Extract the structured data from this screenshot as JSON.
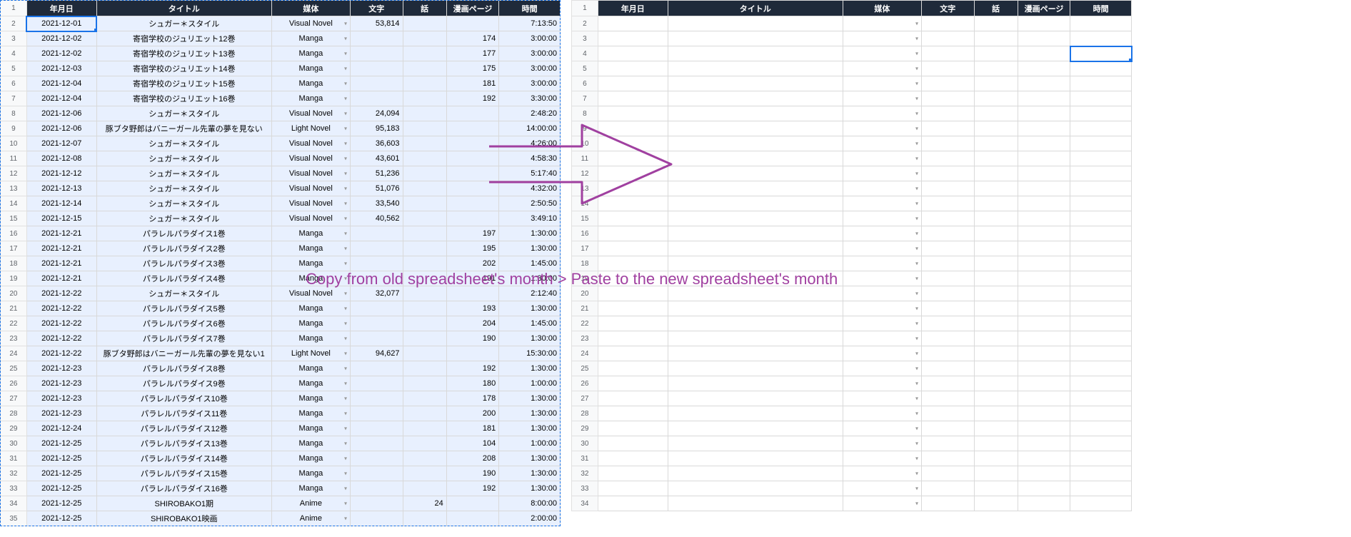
{
  "annotation": "Copy from old spreadsheet's month > Paste to the new spreadsheet's month",
  "headers": {
    "date": "年月日",
    "title": "タイトル",
    "media": "媒体",
    "moji": "文字",
    "wa": "話",
    "page": "漫画ページ",
    "time": "時間"
  },
  "rows": [
    {
      "n": 1
    },
    {
      "n": 2,
      "date": "2021-12-01",
      "title": "シュガー＊スタイル",
      "media": "Visual Novel",
      "moji": "53,814",
      "wa": "",
      "page": "",
      "time": "7:13:50"
    },
    {
      "n": 3,
      "date": "2021-12-02",
      "title": "寄宿学校のジュリエット12巻",
      "media": "Manga",
      "moji": "",
      "wa": "",
      "page": "174",
      "time": "3:00:00"
    },
    {
      "n": 4,
      "date": "2021-12-02",
      "title": "寄宿学校のジュリエット13巻",
      "media": "Manga",
      "moji": "",
      "wa": "",
      "page": "177",
      "time": "3:00:00"
    },
    {
      "n": 5,
      "date": "2021-12-03",
      "title": "寄宿学校のジュリエット14巻",
      "media": "Manga",
      "moji": "",
      "wa": "",
      "page": "175",
      "time": "3:00:00"
    },
    {
      "n": 6,
      "date": "2021-12-04",
      "title": "寄宿学校のジュリエット15巻",
      "media": "Manga",
      "moji": "",
      "wa": "",
      "page": "181",
      "time": "3:00:00"
    },
    {
      "n": 7,
      "date": "2021-12-04",
      "title": "寄宿学校のジュリエット16巻",
      "media": "Manga",
      "moji": "",
      "wa": "",
      "page": "192",
      "time": "3:30:00"
    },
    {
      "n": 8,
      "date": "2021-12-06",
      "title": "シュガー＊スタイル",
      "media": "Visual Novel",
      "moji": "24,094",
      "wa": "",
      "page": "",
      "time": "2:48:20"
    },
    {
      "n": 9,
      "date": "2021-12-06",
      "title": "豚ブタ野郎はバニーガール先輩の夢を見ない",
      "media": "Light Novel",
      "moji": "95,183",
      "wa": "",
      "page": "",
      "time": "14:00:00"
    },
    {
      "n": 10,
      "date": "2021-12-07",
      "title": "シュガー＊スタイル",
      "media": "Visual Novel",
      "moji": "36,603",
      "wa": "",
      "page": "",
      "time": "4:26:00"
    },
    {
      "n": 11,
      "date": "2021-12-08",
      "title": "シュガー＊スタイル",
      "media": "Visual Novel",
      "moji": "43,601",
      "wa": "",
      "page": "",
      "time": "4:58:30"
    },
    {
      "n": 12,
      "date": "2021-12-12",
      "title": "シュガー＊スタイル",
      "media": "Visual Novel",
      "moji": "51,236",
      "wa": "",
      "page": "",
      "time": "5:17:40"
    },
    {
      "n": 13,
      "date": "2021-12-13",
      "title": "シュガー＊スタイル",
      "media": "Visual Novel",
      "moji": "51,076",
      "wa": "",
      "page": "",
      "time": "4:32:00"
    },
    {
      "n": 14,
      "date": "2021-12-14",
      "title": "シュガー＊スタイル",
      "media": "Visual Novel",
      "moji": "33,540",
      "wa": "",
      "page": "",
      "time": "2:50:50"
    },
    {
      "n": 15,
      "date": "2021-12-15",
      "title": "シュガー＊スタイル",
      "media": "Visual Novel",
      "moji": "40,562",
      "wa": "",
      "page": "",
      "time": "3:49:10"
    },
    {
      "n": 16,
      "date": "2021-12-21",
      "title": "パラレルパラダイス1巻",
      "media": "Manga",
      "moji": "",
      "wa": "",
      "page": "197",
      "time": "1:30:00"
    },
    {
      "n": 17,
      "date": "2021-12-21",
      "title": "パラレルパラダイス2巻",
      "media": "Manga",
      "moji": "",
      "wa": "",
      "page": "195",
      "time": "1:30:00"
    },
    {
      "n": 18,
      "date": "2021-12-21",
      "title": "パラレルパラダイス3巻",
      "media": "Manga",
      "moji": "",
      "wa": "",
      "page": "202",
      "time": "1:45:00"
    },
    {
      "n": 19,
      "date": "2021-12-21",
      "title": "パラレルパラダイス4巻",
      "media": "Manga",
      "moji": "",
      "wa": "",
      "page": "191",
      "time": "1:30:00"
    },
    {
      "n": 20,
      "date": "2021-12-22",
      "title": "シュガー＊スタイル",
      "media": "Visual Novel",
      "moji": "32,077",
      "wa": "",
      "page": "",
      "time": "2:12:40"
    },
    {
      "n": 21,
      "date": "2021-12-22",
      "title": "パラレルパラダイス5巻",
      "media": "Manga",
      "moji": "",
      "wa": "",
      "page": "193",
      "time": "1:30:00"
    },
    {
      "n": 22,
      "date": "2021-12-22",
      "title": "パラレルパラダイス6巻",
      "media": "Manga",
      "moji": "",
      "wa": "",
      "page": "204",
      "time": "1:45:00"
    },
    {
      "n": 23,
      "date": "2021-12-22",
      "title": "パラレルパラダイス7巻",
      "media": "Manga",
      "moji": "",
      "wa": "",
      "page": "190",
      "time": "1:30:00"
    },
    {
      "n": 24,
      "date": "2021-12-22",
      "title": "豚ブタ野郎はバニーガール先輩の夢を見ない1",
      "media": "Light Novel",
      "moji": "94,627",
      "wa": "",
      "page": "",
      "time": "15:30:00"
    },
    {
      "n": 25,
      "date": "2021-12-23",
      "title": "パラレルパラダイス8巻",
      "media": "Manga",
      "moji": "",
      "wa": "",
      "page": "192",
      "time": "1:30:00"
    },
    {
      "n": 26,
      "date": "2021-12-23",
      "title": "パラレルパラダイス9巻",
      "media": "Manga",
      "moji": "",
      "wa": "",
      "page": "180",
      "time": "1:00:00"
    },
    {
      "n": 27,
      "date": "2021-12-23",
      "title": "パラレルパラダイス10巻",
      "media": "Manga",
      "moji": "",
      "wa": "",
      "page": "178",
      "time": "1:30:00"
    },
    {
      "n": 28,
      "date": "2021-12-23",
      "title": "パラレルパラダイス11巻",
      "media": "Manga",
      "moji": "",
      "wa": "",
      "page": "200",
      "time": "1:30:00"
    },
    {
      "n": 29,
      "date": "2021-12-24",
      "title": "パラレルパラダイス12巻",
      "media": "Manga",
      "moji": "",
      "wa": "",
      "page": "181",
      "time": "1:30:00"
    },
    {
      "n": 30,
      "date": "2021-12-25",
      "title": "パラレルパラダイス13巻",
      "media": "Manga",
      "moji": "",
      "wa": "",
      "page": "104",
      "time": "1:00:00"
    },
    {
      "n": 31,
      "date": "2021-12-25",
      "title": "パラレルパラダイス14巻",
      "media": "Manga",
      "moji": "",
      "wa": "",
      "page": "208",
      "time": "1:30:00"
    },
    {
      "n": 32,
      "date": "2021-12-25",
      "title": "パラレルパラダイス15巻",
      "media": "Manga",
      "moji": "",
      "wa": "",
      "page": "190",
      "time": "1:30:00"
    },
    {
      "n": 33,
      "date": "2021-12-25",
      "title": "パラレルパラダイス16巻",
      "media": "Manga",
      "moji": "",
      "wa": "",
      "page": "192",
      "time": "1:30:00"
    },
    {
      "n": 34,
      "date": "2021-12-25",
      "title": "SHIROBAKO1期",
      "media": "Anime",
      "moji": "",
      "wa": "24",
      "page": "",
      "time": "8:00:00"
    },
    {
      "n": 35,
      "date": "2021-12-25",
      "title": "SHIROBAKO1映画",
      "media": "Anime",
      "moji": "",
      "wa": "",
      "page": "",
      "time": "2:00:00"
    }
  ],
  "rightRows": 34,
  "rightActiveRow": 4
}
